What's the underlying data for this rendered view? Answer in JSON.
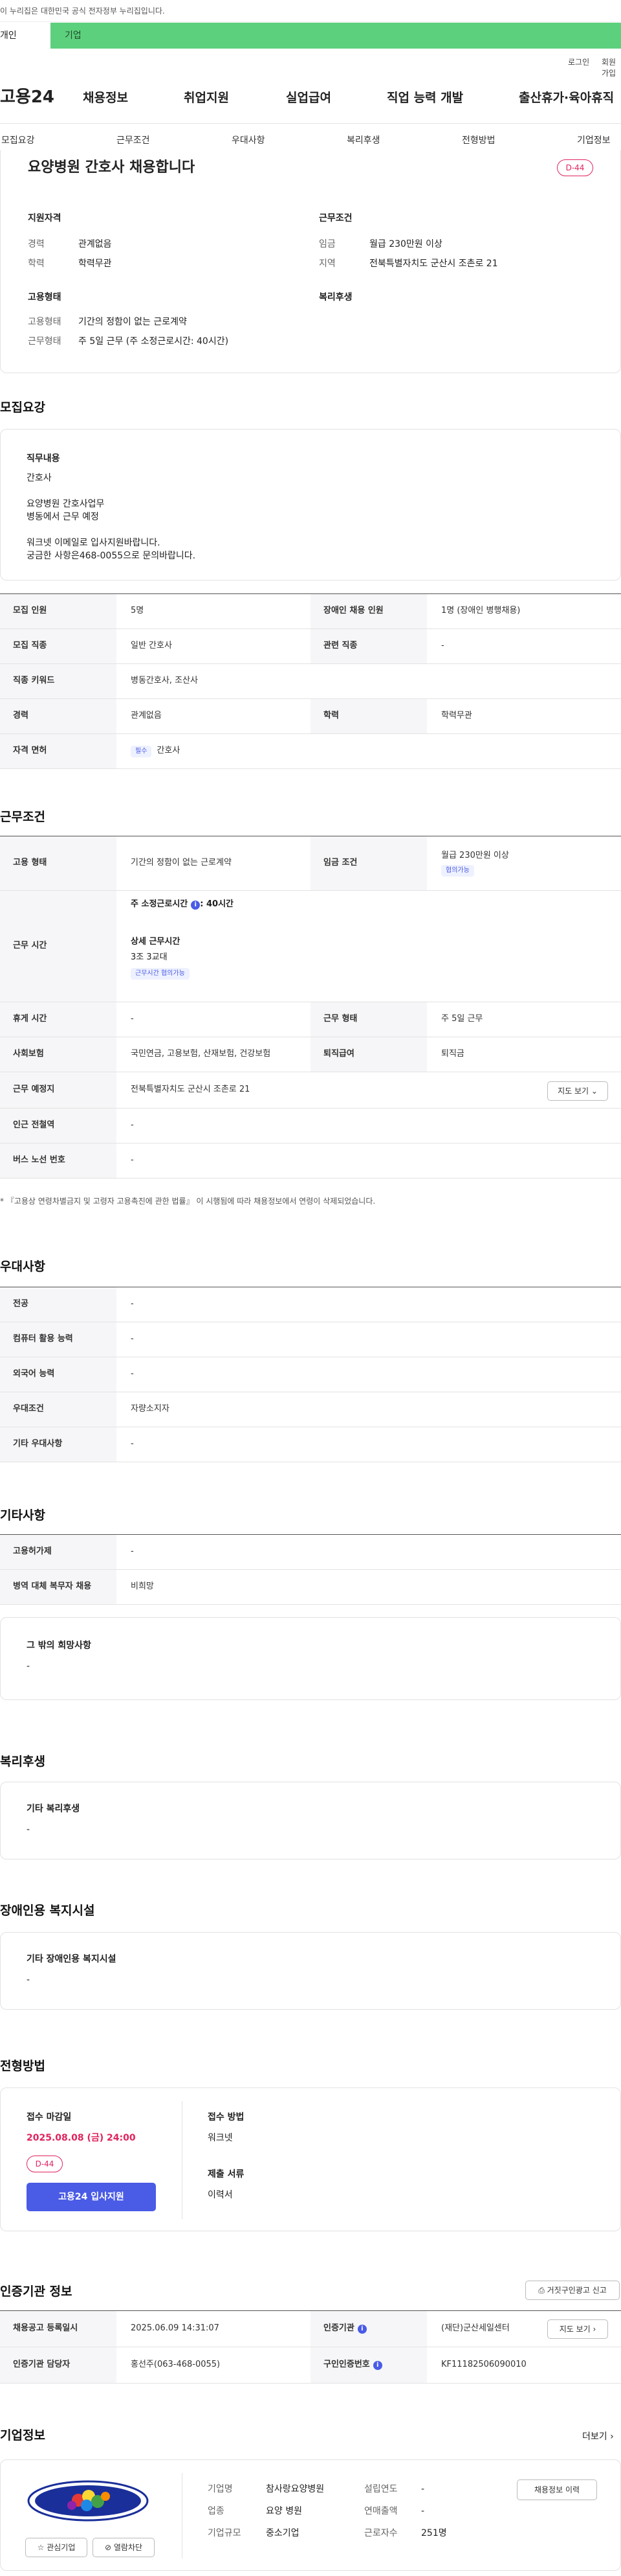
{
  "notice": {
    "text": "이 누리집은 대한민국 공식 전자정부 누리집입니다."
  },
  "user_tabs": {
    "individual": "개인",
    "company": "기업"
  },
  "util": {
    "login": "로그인",
    "join": "회원가입"
  },
  "logo": "고용24",
  "gnb": [
    "채용정보",
    "취업지원",
    "실업급여",
    "직업 능력 개발",
    "출산휴가·육아휴직"
  ],
  "subnav": [
    "모집요강",
    "근무조건",
    "우대사항",
    "복리후생",
    "전형방법",
    "기업정보"
  ],
  "summary": {
    "title": "요양병원 간호사 채용합니다",
    "dday": "D-44",
    "qualification": {
      "heading": "지원자격",
      "rows": [
        {
          "k": "경력",
          "v": "관계없음"
        },
        {
          "k": "학력",
          "v": "학력무관"
        }
      ]
    },
    "conditions": {
      "heading": "근무조건",
      "rows": [
        {
          "k": "임금",
          "v": "월급 230만원 이상"
        },
        {
          "k": "지역",
          "v": "전북특별자치도 군산시 조촌로 21"
        }
      ]
    },
    "employment": {
      "heading": "고용형태",
      "rows": [
        {
          "k": "고용형태",
          "v": "기간의 정함이 없는 근로계약"
        },
        {
          "k": "근무형태",
          "v": "주 5일 근무 (주 소정근로시간: 40시간)"
        }
      ]
    },
    "welfare_heading": "복리후생"
  },
  "recruit": {
    "heading": "모집요강",
    "job_box": {
      "heading": "직무내용",
      "lines": [
        "간호사",
        "",
        "요양병원 간호사업무",
        "병동에서 근무 예정",
        "",
        "워크넷 이메일로 입사지원바랍니다.",
        "궁금한 사항은468-0055으로 문의바랍니다."
      ]
    },
    "table": {
      "headcount_label": "모집 인원",
      "headcount": "5명",
      "disabled_label": "장애인 채용 인원",
      "disabled": "1명 (장애인 병행채용)",
      "job_label": "모집 직종",
      "job": "일반 간호사",
      "related_label": "관련 직종",
      "related": "-",
      "keyword_label": "직종 키워드",
      "keyword": "병동간호사, 조산사",
      "career_label": "경력",
      "career": "관계없음",
      "edu_label": "학력",
      "edu": "학력무관",
      "license_label": "자격 면허",
      "license_tag": "필수",
      "license": "간호사"
    }
  },
  "conditions": {
    "heading": "근무조건",
    "type_label": "고용 형태",
    "type": "기간의 정함이 없는 근로계약",
    "wage_label": "임금 조건",
    "wage": "월급 230만원 이상",
    "wage_tag": "협의가능",
    "hours_label": "근무 시간",
    "hours_week": "주 소정근로시간",
    "hours_value": ": 40시간",
    "detail_label": "상세 근무시간",
    "detail_value": "3조 3교대",
    "detail_tag": "근무시간 협의가능",
    "holiday_label": "휴게 시간",
    "holiday": "-",
    "worktype_label": "근무 형태",
    "worktype": "주 5일 근무",
    "insurance_label": "사회보험",
    "insurance": "국민연금, 고용보험, 산재보험, 건강보험",
    "severance_label": "퇴직급여",
    "severance": "퇴직금",
    "place_label": "근무 예정지",
    "place": "전북특별자치도 군산시 조촌로 21",
    "map_btn": "지도 보기",
    "subway_label": "인근 전철역",
    "subway": "-",
    "bus_label": "버스 노선 번호",
    "bus": "-",
    "note": "* 『고용상 연령차별금지 및 고령자 고용촉진에 관한 법률』 이 시행됨에 따라 채용정보에서 연령이 삭제되었습니다."
  },
  "preferred": {
    "heading": "우대사항",
    "rows": [
      {
        "k": "전공",
        "v": "-"
      },
      {
        "k": "컴퓨터 활용 능력",
        "v": "-"
      },
      {
        "k": "외국어 능력",
        "v": "-"
      },
      {
        "k": "우대조건",
        "v": "자량소지자"
      },
      {
        "k": "기타 우대사항",
        "v": "-"
      }
    ]
  },
  "etc": {
    "heading": "기타사항",
    "rows": [
      {
        "k": "고용허가제",
        "v": "-"
      },
      {
        "k": "병역 대체 복무자 채용",
        "v": "비희망"
      }
    ],
    "box_heading": "그 밖의 희망사항",
    "box_value": "-"
  },
  "welfare": {
    "heading": "복리후생",
    "box_heading": "기타 복리후생",
    "box_value": "-"
  },
  "disabled_facility": {
    "heading": "장애인용 복지시설",
    "box_heading": "기타 장애인용 복지시설",
    "box_value": "-"
  },
  "selection": {
    "heading": "전형방법",
    "deadline_label": "접수 마감일",
    "deadline": "2025.08.08 (금) 24:00",
    "dday": "D-44",
    "apply_btn": "고용24 입사지원",
    "method_label": "접수 방법",
    "method": "워크넷",
    "docs_label": "제출 서류",
    "docs": "이력서"
  },
  "agency": {
    "heading": "인증기관 정보",
    "report_btn": "거짓구인광고 신고",
    "reg_label": "채용공고 등록일시",
    "reg": "2025.06.09 14:31:07",
    "agency_label": "인증기관",
    "agency": "(재단)군산세일센터",
    "map_btn": "지도 보기",
    "manager_label": "인증기관 담당자",
    "manager": "홍선주(063-468-0055)",
    "regno_label": "구인인증번호",
    "regno": "KF11182506090010"
  },
  "company": {
    "heading": "기업정보",
    "more": "더보기",
    "name_label": "기업명",
    "name": "참사랑요양병원",
    "founded_label": "설립연도",
    "founded": "-",
    "history_btn": "채용정보 이력",
    "industry_label": "업종",
    "industry": "요양 병원",
    "sales_label": "연매출액",
    "sales": "-",
    "size_label": "기업규모",
    "size": "중소기업",
    "employees_label": "근로자수",
    "employees": "251명",
    "fav_btn": "관심기업",
    "block_btn": "열람차단"
  },
  "colors": {
    "accent": "#4a5be6",
    "brand_green": "#5dd07d",
    "dday": "#e0245e"
  }
}
